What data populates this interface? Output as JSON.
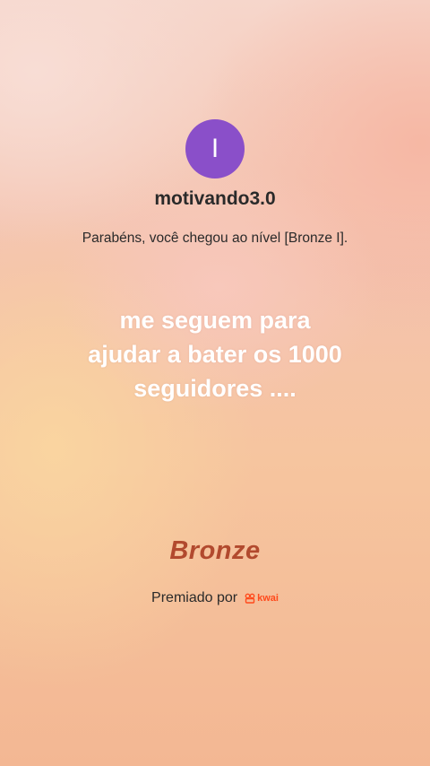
{
  "profile": {
    "avatar_letter": "I",
    "avatar_color": "#8a4fc9",
    "username": "motivando3.0"
  },
  "message": {
    "level_text": "Parabéns, você chegou ao nível [Bronze I]."
  },
  "caption": {
    "lines": [
      "me seguem para",
      "ajudar a bater os 1000",
      "seguidores ...."
    ]
  },
  "badge": {
    "label": "Bronze",
    "color": "#b24a2e"
  },
  "footer": {
    "awarded_by": "Premiado por",
    "brand_icon": "kwai-logo-icon",
    "brand_name": "kwai",
    "brand_color": "#ff4a1c"
  }
}
